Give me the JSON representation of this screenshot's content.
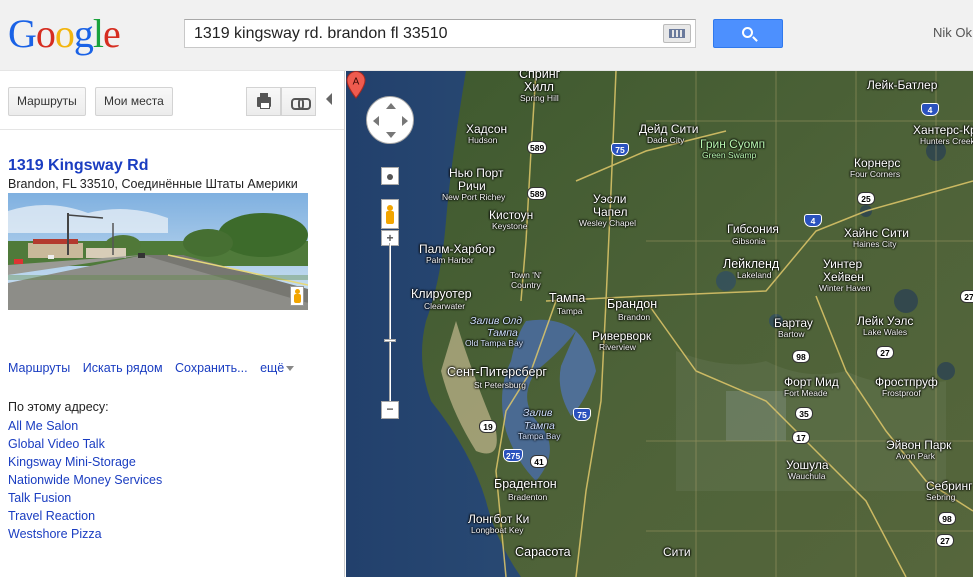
{
  "header": {
    "logo": [
      "G",
      "o",
      "o",
      "g",
      "l",
      "e"
    ],
    "search_query": "1319 kingsway rd. brandon fl 33510",
    "user_name": "Nik Ok"
  },
  "toolbar": {
    "directions_label": "Маршруты",
    "my_places_label": "Мои места"
  },
  "place": {
    "title": "1319 Kingsway Rd",
    "address": "Brandon, FL 33510, Соединённые Штаты Америки",
    "actions": {
      "directions": "Маршруты",
      "search_nearby": "Искать рядом",
      "save": "Сохранить...",
      "more": "ещё"
    },
    "at_address_label": "По этому адресу:",
    "businesses": [
      "All Me Salon",
      "Global Video Talk",
      "Kingsway Mini-Storage",
      "Nationwide Money Services",
      "Talk Fusion",
      "Travel Reaction",
      "Westshore Pizza"
    ]
  },
  "map": {
    "marker_label": "A",
    "labels": {
      "spring_hill_ru": "Спринг",
      "spring_hill_ru2": "Хилл",
      "spring_hill_en": "Spring Hill",
      "hudson_ru": "Хадсон",
      "hudson_en": "Hudson",
      "dade_city_ru": "Дейд Сити",
      "dade_city_en": "Dade City",
      "green_swamp_ru": "Грин Суомп",
      "green_swamp_en": "Green Swamp",
      "lake_butler_ru": "Лейк-Батлер",
      "hunters_creek_ru": "Хантерс-Крик",
      "hunters_creek_en": "Hunters Creek",
      "corners_ru": "Корнерс",
      "corners_en": "Four Corners",
      "new_port_richey_ru": "Нью Порт",
      "new_port_richey_ru2": "Ричи",
      "new_port_richey_en": "New Port Richey",
      "wesley_chapel_ru": "Уэсли",
      "wesley_chapel_ru2": "Чапел",
      "wesley_chapel_en": "Wesley Chapel",
      "keystone_ru": "Кистоун",
      "keystone_en": "Keystone",
      "gibsonia_ru": "Гибсония",
      "gibsonia_en": "Gibsonia",
      "haines_city_ru": "Хайнс Сити",
      "haines_city_en": "Haines City",
      "palm_harbor_ru": "Палм-Харбор",
      "palm_harbor_en": "Palm Harbor",
      "town_country_en": "Town 'N'",
      "town_country_en2": "Country",
      "lakeland_ru": "Лейкленд",
      "lakeland_en": "Lakeland",
      "winter_haven_ru": "Уинтер",
      "winter_haven_ru2": "Хейвен",
      "winter_haven_en": "Winter Haven",
      "clearwater_ru": "Клируотер",
      "clearwater_en": "Clearwater",
      "tampa_ru": "Тампа",
      "tampa_en": "Tampa",
      "brandon_ru": "Брандон",
      "brandon_en": "Brandon",
      "old_tampa_bay_ru": "Залив Олд",
      "old_tampa_bay_ru2": "Тампа",
      "old_tampa_bay_en": "Old Tampa Bay",
      "riverview_ru": "Риверворк",
      "riverview_en": "Riverview",
      "bartow_ru": "Бартау",
      "bartow_en": "Bartow",
      "lake_wales_ru": "Лейк Уэлс",
      "lake_wales_en": "Lake Wales",
      "st_petersburg_ru": "Сент-Питерсберг",
      "st_petersburg_en": "St Petersburg",
      "fort_meade_ru": "Форт Мид",
      "fort_meade_en": "Fort Meade",
      "frostproof_ru": "Фростпруф",
      "frostproof_en": "Frostproof",
      "tampa_bay_ru": "Залив",
      "tampa_bay_ru2": "Тампа",
      "tampa_bay_en": "Tampa Bay",
      "avon_park_ru": "Эйвон Парк",
      "avon_park_en": "Avon Park",
      "wauchula_ru": "Уошула",
      "wauchula_en": "Wauchula",
      "bradenton_ru": "Брадентон",
      "bradenton_en": "Bradenton",
      "sebring_ru": "Себринг",
      "sebring_en": "Sebring",
      "longboat_ru": "Лонгбот Ки",
      "longboat_en": "Longboat Key",
      "sarasota_ru": "Сарасота",
      "sity_ru": "Сити"
    },
    "shields": {
      "r589a": "589",
      "r589b": "589",
      "i75a": "75",
      "i75b": "75",
      "i4a": "4",
      "i4b": "4",
      "r25": "25",
      "r27a": "27",
      "r27b": "27",
      "r98a": "98",
      "r98b": "98",
      "r35": "35",
      "r17": "17",
      "r19": "19",
      "r41": "41",
      "i275": "275",
      "r27c": "27"
    },
    "controls": {
      "zoom_in": "+",
      "zoom_out": "−",
      "zoom_out2": "−"
    }
  }
}
